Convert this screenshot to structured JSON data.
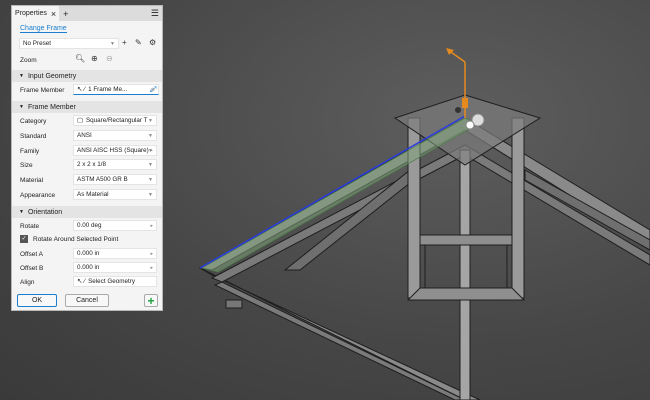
{
  "panel": {
    "tab_label": "Properties",
    "change_frame": "Change Frame",
    "preset": "No Preset",
    "zoom_label": "Zoom",
    "input_geometry": {
      "header": "Input Geometry",
      "frame_member_label": "Frame Member",
      "frame_member_value": "1 Frame Me..."
    },
    "frame_member": {
      "header": "Frame Member",
      "rows": [
        {
          "label": "Category",
          "value": "Square/Rectangular T"
        },
        {
          "label": "Standard",
          "value": "ANSI"
        },
        {
          "label": "Family",
          "value": "ANSI AISC HSS (Square) -"
        },
        {
          "label": "Size",
          "value": "2 x 2 x 1/8"
        },
        {
          "label": "Material",
          "value": "ASTM A500 GR B"
        },
        {
          "label": "Appearance",
          "value": "As Material"
        }
      ]
    },
    "orientation": {
      "header": "Orientation",
      "rotate_label": "Rotate",
      "rotate_value": "0.00 deg",
      "rotate_checkbox": "Rotate Around Selected Point",
      "rotate_checked": true,
      "offset_a_label": "Offset A",
      "offset_a_value": "0.000 in",
      "offset_b_label": "Offset B",
      "offset_b_value": "0.000 in",
      "align_label": "Align",
      "align_value": "Select Geometry"
    },
    "ok": "OK",
    "cancel": "Cancel"
  },
  "colors": {
    "accent": "#1a7fd0",
    "selected_edge": "#2a3be0",
    "preview": "#7fa27a",
    "triad": "#e58a1f",
    "add": "#1aa23a"
  }
}
